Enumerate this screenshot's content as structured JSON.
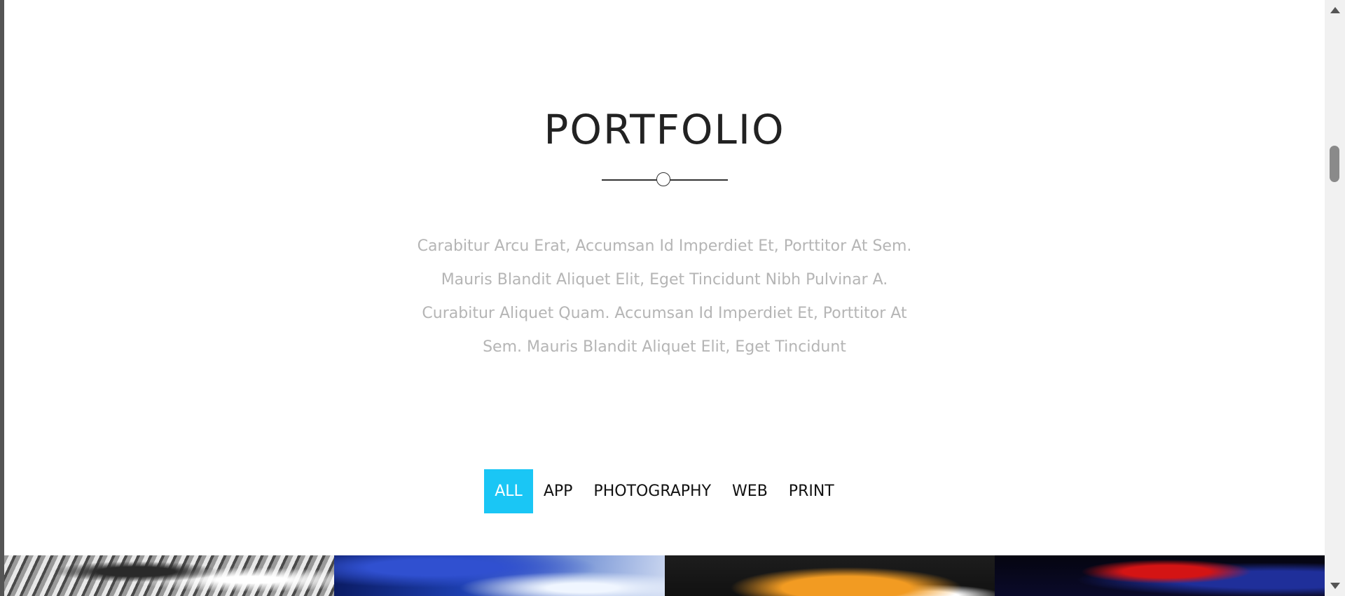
{
  "section": {
    "title": "PORTFOLIO",
    "intro": "Carabitur Arcu Erat, Accumsan Id Imperdiet Et, Porttitor At Sem. Mauris Blandit Aliquet Elit, Eget Tincidunt Nibh Pulvinar A. Curabitur Aliquet Quam. Accumsan Id Imperdiet Et, Porttitor At Sem. Mauris Blandit Aliquet Elit, Eget Tincidunt"
  },
  "filters": [
    {
      "label": "ALL",
      "active": true
    },
    {
      "label": "APP",
      "active": false
    },
    {
      "label": "PHOTOGRAPHY",
      "active": false
    },
    {
      "label": "WEB",
      "active": false
    },
    {
      "label": "PRINT",
      "active": false
    }
  ],
  "colors": {
    "accent": "#1ac6f5",
    "title": "#222222",
    "intro_text": "#b5b5b5"
  },
  "gallery": [
    {
      "image": "grayscale-character-artwork"
    },
    {
      "image": "blue-abstract-artwork"
    },
    {
      "image": "orange-flame-artwork"
    },
    {
      "image": "red-blue-dark-artwork"
    }
  ]
}
